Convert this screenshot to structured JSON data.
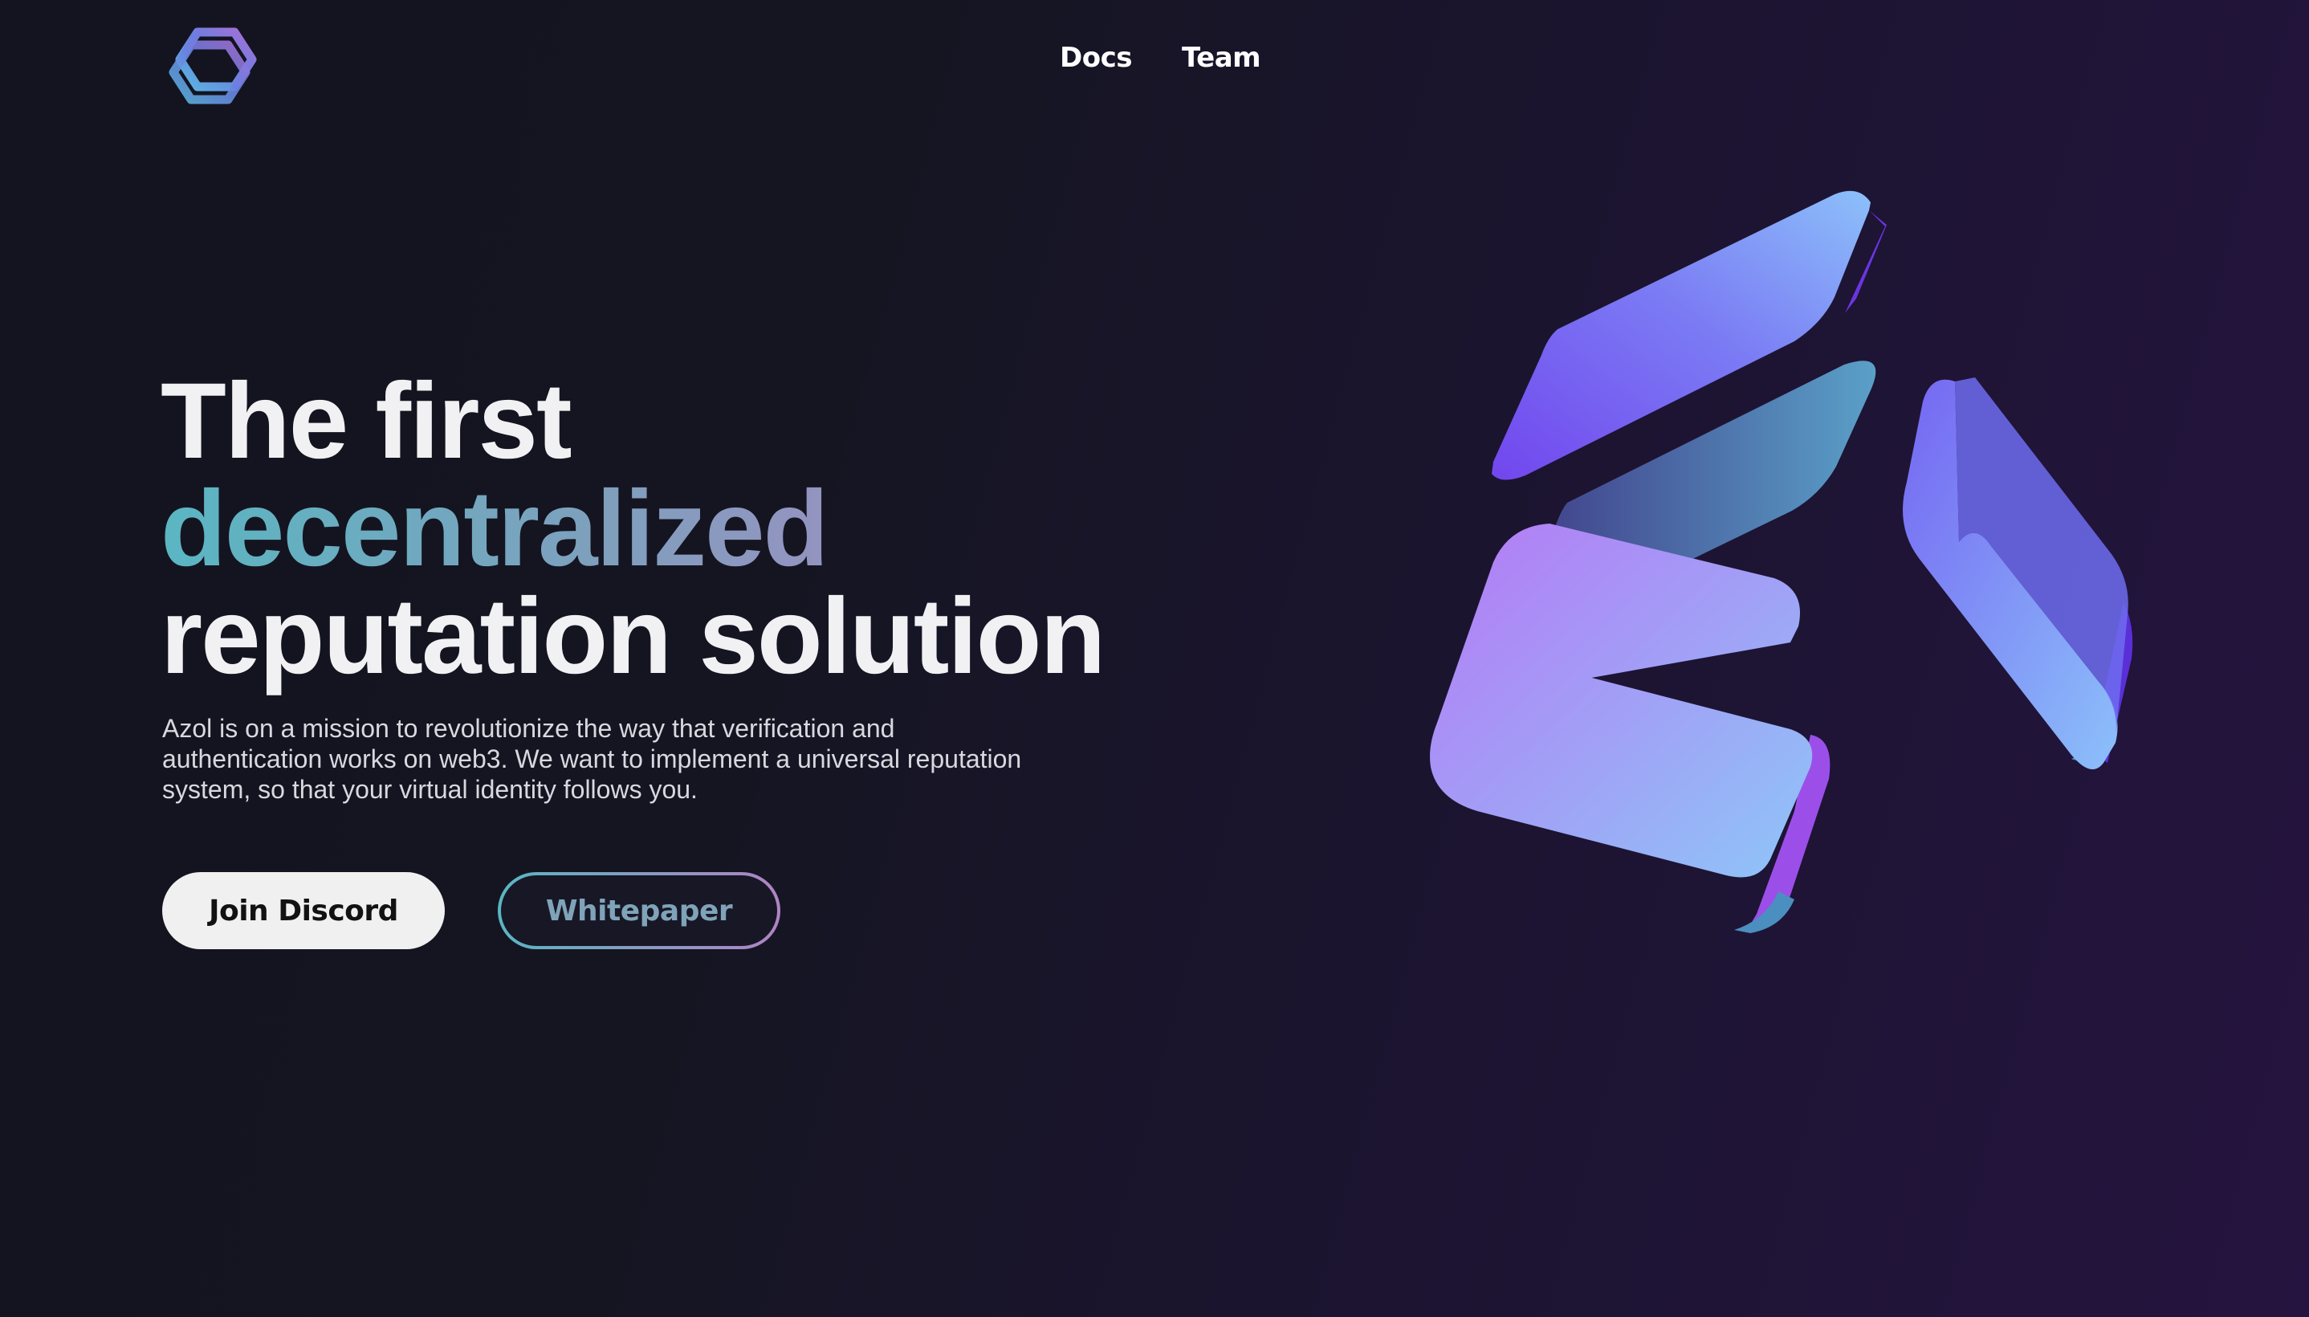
{
  "header": {
    "logo_icon": "hexagon-logo-icon",
    "nav": [
      {
        "label": "Docs"
      },
      {
        "label": "Team"
      }
    ]
  },
  "hero": {
    "headline_line1": "The first",
    "headline_line2": "decentralized",
    "headline_line3": "reputation solution",
    "description": "Azol is on a mission to revolutionize the way that verification and authentication works on web3. We want to implement a universal reputation system, so that your virtual identity follows you.",
    "primary_button": "Join Discord",
    "secondary_button": "Whitepaper"
  },
  "colors": {
    "background_start": "#13141f",
    "background_end": "#25143f",
    "gradient_text_start": "#5ab6c2",
    "gradient_text_end": "#b083c4",
    "primary_button_bg": "#f0f0f0",
    "card_purple": "#7b55f2",
    "card_blue": "#8ab4f8"
  }
}
